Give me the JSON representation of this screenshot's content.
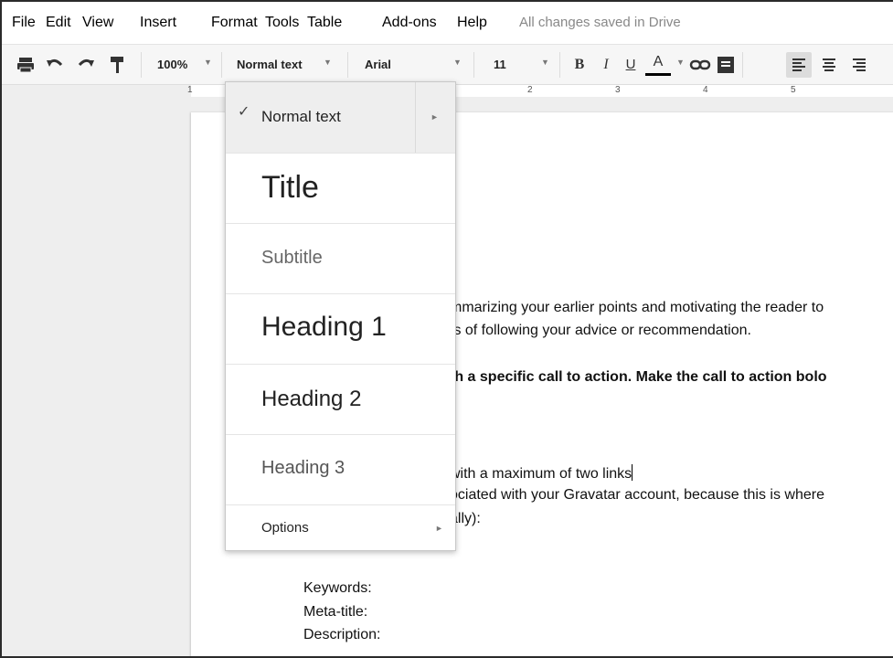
{
  "menubar": {
    "items": [
      "File",
      "Edit",
      "View",
      "Insert",
      "Format",
      "Tools",
      "Table",
      "Add-ons",
      "Help"
    ],
    "save_status": "All changes saved in Drive"
  },
  "toolbar": {
    "zoom": "100%",
    "style": "Normal text",
    "font": "Arial",
    "font_size": "11",
    "icons": [
      "print-icon",
      "undo-icon",
      "redo-icon",
      "paint-format-icon",
      "bold-icon",
      "italic-icon",
      "underline-icon",
      "text-color-icon",
      "link-icon",
      "comment-icon",
      "align-left-icon",
      "align-center-icon",
      "align-right-icon"
    ],
    "bold_glyph": "B",
    "italic_glyph": "I",
    "underline_glyph": "U",
    "text_color_glyph": "A"
  },
  "ruler": {
    "numbers": [
      "1",
      "2",
      "3",
      "4",
      "5"
    ]
  },
  "document": {
    "lines": [
      "mmarizing your earlier points and motivating the reader to",
      "ts of following your advice or recommendation.",
      "th a specific call to action. Make the call to action bolo",
      "with a maximum of two links",
      "ociated with your Gravatar account, because this is where",
      "ally):",
      "Keywords:",
      "Meta-title:",
      "Description:"
    ]
  },
  "styles_menu": {
    "items": [
      "Normal text",
      "Title",
      "Subtitle",
      "Heading 1",
      "Heading 2",
      "Heading 3",
      "Options"
    ],
    "checkmark": "✓",
    "arrow": "►"
  },
  "colors": {
    "toolbar_bg": "#f6f6f6",
    "canvas_bg": "#eeeeee",
    "text_color_underline": "#000000",
    "muted_text": "#888888"
  }
}
